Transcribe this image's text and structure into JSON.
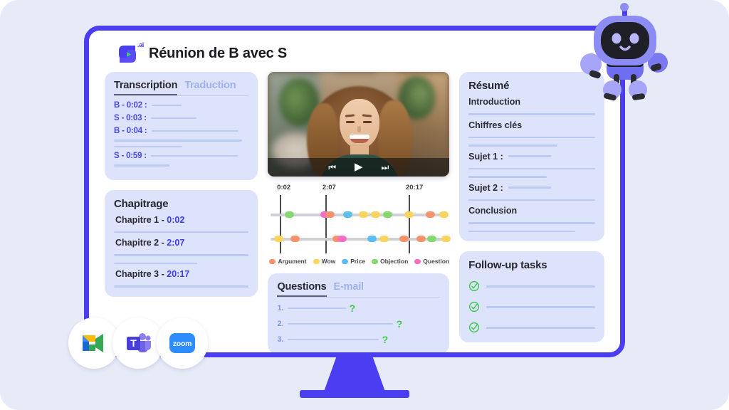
{
  "app": {
    "logo_icon": "leexi-logo-icon",
    "logo_suffix": ".ai",
    "title": "Réunion de B avec S"
  },
  "transcription": {
    "tabs": [
      {
        "label": "Transcription",
        "active": true
      },
      {
        "label": "Traduction",
        "active": false
      }
    ],
    "entries": [
      {
        "label": "B - 0:02 :",
        "line_width": 42
      },
      {
        "label": "S - 0:03 :",
        "line_width": 64
      },
      {
        "label": "B - 0:04 :",
        "line_width": 122
      },
      {
        "label": "",
        "line_width": 180
      },
      {
        "label": "",
        "line_width": 96
      },
      {
        "label": "S - 0:59 :",
        "line_width": 122
      },
      {
        "label": "",
        "line_width": 78
      }
    ]
  },
  "chapitrage": {
    "title": "Chapitrage",
    "chapters": [
      {
        "name": "Chapitre 1 - ",
        "time": "0:02",
        "lines": [
          100
        ]
      },
      {
        "name": "Chapitre 2 - ",
        "time": "2:07",
        "lines": [
          100,
          62
        ]
      },
      {
        "name": "Chapitre 3 - ",
        "time": "20:17",
        "lines": [
          100
        ]
      }
    ]
  },
  "video": {
    "alt": "woman-smiling-video-thumbnail",
    "controls": {
      "previous": "⏮",
      "play": "▶",
      "next": "⏭"
    }
  },
  "timeline": {
    "ticks": [
      {
        "label": "0:02",
        "pos": 5
      },
      {
        "label": "2:07",
        "pos": 30
      },
      {
        "label": "20:17",
        "pos": 76
      }
    ],
    "tracks": [
      {
        "name": "track-upper",
        "dots": [
          {
            "pos": 8,
            "type": "Objection"
          },
          {
            "pos": 28,
            "type": "Question"
          },
          {
            "pos": 31,
            "type": "Argument"
          },
          {
            "pos": 41,
            "type": "Price"
          },
          {
            "pos": 50,
            "type": "Wow"
          },
          {
            "pos": 57,
            "type": "Wow"
          },
          {
            "pos": 64,
            "type": "Objection"
          },
          {
            "pos": 76,
            "type": "Wow"
          },
          {
            "pos": 88,
            "type": "Argument"
          },
          {
            "pos": 96,
            "type": "Wow"
          }
        ]
      },
      {
        "name": "track-lower",
        "dots": [
          {
            "pos": 2,
            "type": "Wow"
          },
          {
            "pos": 11,
            "type": "Argument"
          },
          {
            "pos": 35,
            "type": "Argument"
          },
          {
            "pos": 38,
            "type": "Question"
          },
          {
            "pos": 55,
            "type": "Price"
          },
          {
            "pos": 62,
            "type": "Wow"
          },
          {
            "pos": 73,
            "type": "Argument"
          },
          {
            "pos": 83,
            "type": "Argument"
          },
          {
            "pos": 89,
            "type": "Objection"
          },
          {
            "pos": 97,
            "type": "Wow"
          }
        ]
      }
    ],
    "legend": [
      {
        "label": "Argument",
        "color": "#f7936a"
      },
      {
        "label": "Wow",
        "color": "#fbd45e"
      },
      {
        "label": "Price",
        "color": "#5bbdf0"
      },
      {
        "label": "Objection",
        "color": "#84d96e"
      },
      {
        "label": "Question",
        "color": "#f86ec4"
      }
    ]
  },
  "questions": {
    "tabs": [
      {
        "label": "Questions",
        "active": true
      },
      {
        "label": "E-mail",
        "active": false
      }
    ],
    "items": [
      {
        "num": "1.",
        "line_width": 82,
        "mark": "?"
      },
      {
        "num": "2.",
        "line_width": 148,
        "mark": "?"
      },
      {
        "num": "3.",
        "line_width": 128,
        "mark": "?"
      }
    ]
  },
  "resume": {
    "title": "Résumé",
    "sections": [
      {
        "heading": "Introduction",
        "inline_line": 0,
        "lines": [
          100
        ]
      },
      {
        "heading": "Chiffres clés",
        "inline_line": 0,
        "lines": [
          100,
          70
        ]
      },
      {
        "heading": "Sujet 1 :",
        "inline_line": 60,
        "lines": [
          100,
          62
        ]
      },
      {
        "heading": "Sujet 2 :",
        "inline_line": 60,
        "lines": [
          100
        ]
      },
      {
        "heading": "Conclusion",
        "inline_line": 0,
        "lines": [
          100,
          84
        ]
      }
    ]
  },
  "tasks": {
    "title": "Follow-up tasks",
    "items": [
      {
        "icon": "check-circle-icon",
        "line_width": 100
      },
      {
        "icon": "check-circle-icon",
        "line_width": 100
      },
      {
        "icon": "check-circle-icon",
        "line_width": 100
      }
    ]
  },
  "integrations": [
    {
      "name": "google-meet-icon",
      "label": "Google Meet"
    },
    {
      "name": "microsoft-teams-icon",
      "label": "Microsoft Teams"
    },
    {
      "name": "zoom-icon",
      "label": "zoom"
    }
  ],
  "mascot": {
    "name": "robot-mascot",
    "label": "AI assistant robot"
  },
  "colors": {
    "accent": "#4b3df0",
    "panel": "#dde3fa",
    "backdrop": "#e7ebf8",
    "line": "#b9caf5",
    "check": "#3ec94f"
  }
}
